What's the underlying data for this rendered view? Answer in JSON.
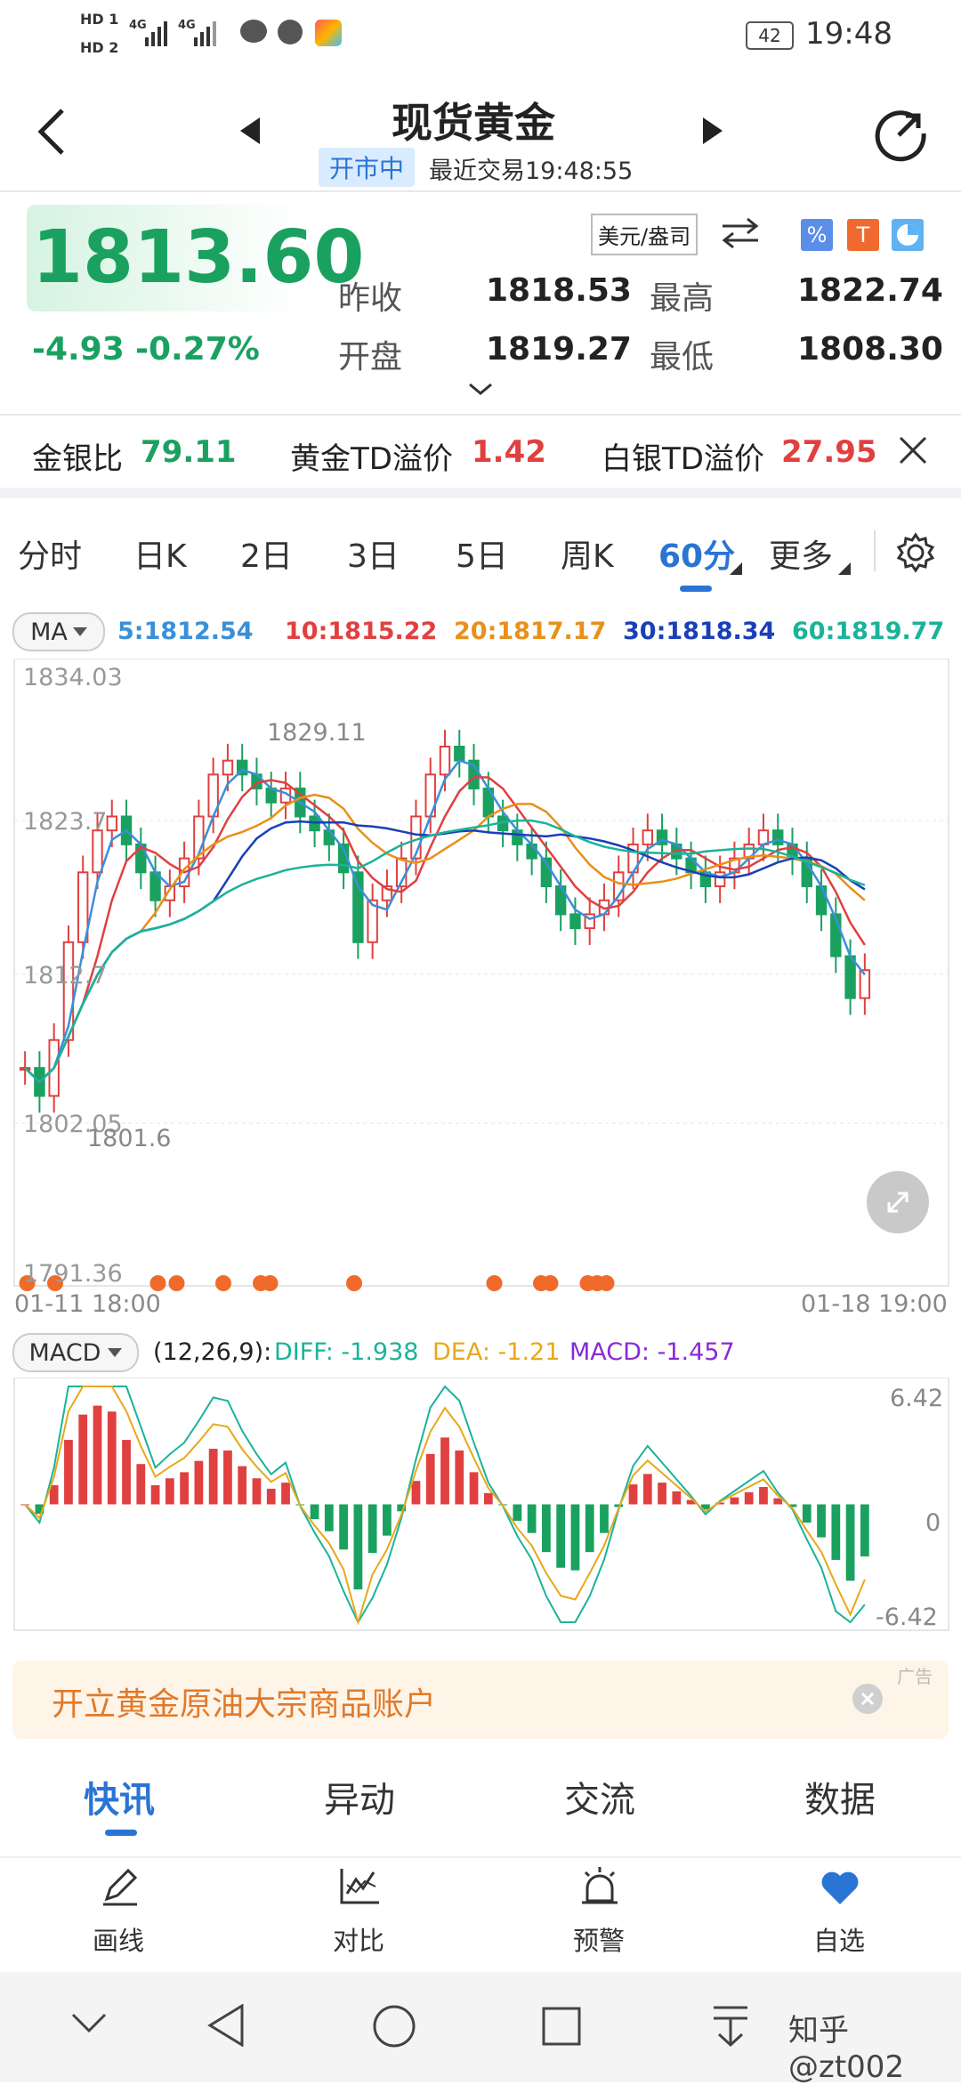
{
  "status": {
    "sim1": "HD 1",
    "sim2": "HD 2",
    "net1": "4G",
    "net2": "4G",
    "battery": "42",
    "time": "19:48"
  },
  "header": {
    "title": "现货黄金",
    "market_status": "开市中",
    "last_trade": "最近交易19:48:55"
  },
  "quote": {
    "price": "1813.60",
    "change": "-4.93",
    "change_pct": "-0.27%",
    "unit": "美元/盎司",
    "prev_close_label": "昨收",
    "prev_close": "1818.53",
    "open_label": "开盘",
    "open": "1819.27",
    "high_label": "最高",
    "high": "1822.74",
    "low_label": "最低",
    "low": "1808.30"
  },
  "spreads": {
    "gold_silver_label": "金银比",
    "gold_silver": "79.11",
    "gold_td_label": "黄金TD溢价",
    "gold_td": "1.42",
    "silver_td_label": "白银TD溢价",
    "silver_td": "27.95"
  },
  "period_tabs": [
    "分时",
    "日K",
    "2日",
    "3日",
    "5日",
    "周K",
    "60分",
    "更多"
  ],
  "ma": {
    "selector": "MA",
    "ma5": "5:1812.54",
    "ma10": "10:1815.22",
    "ma20": "20:1817.17",
    "ma30": "30:1818.34",
    "ma60": "60:1819.77",
    "colors": {
      "ma5": "#3a8fd9",
      "ma10": "#e04040",
      "ma20": "#e8901a",
      "ma30": "#1a3fb8",
      "ma60": "#1ab39a"
    }
  },
  "chart_data": [
    {
      "type": "candlestick",
      "title": "",
      "y_ticks": [
        "1834.03",
        "1823.7",
        "1812.7",
        "1802.05",
        "1791.36"
      ],
      "annotations": [
        "1829.11",
        "1801.6"
      ],
      "x_labels": [
        "01-11 18:00",
        "01-18 19:00"
      ],
      "ylim": [
        1791.36,
        1834.03
      ],
      "colors": {
        "up": "#e04040",
        "down": "#1aa160"
      }
    },
    {
      "type": "macd",
      "params": "(12,26,9):",
      "diff": "DIFF: -1.938",
      "dea": "DEA: -1.21",
      "macd": "MACD: -1.457",
      "y_ticks": [
        "6.42",
        "0",
        "-6.42"
      ],
      "ylim": [
        -6.42,
        6.42
      ]
    }
  ],
  "macd_selector": "MACD",
  "ad": {
    "text": "开立黄金原油大宗商品账户",
    "tag": "广告"
  },
  "bottom_tabs": [
    "快讯",
    "异动",
    "交流",
    "数据"
  ],
  "tools": [
    {
      "label": "画线",
      "icon": "pen-icon"
    },
    {
      "label": "对比",
      "icon": "compare-chart-icon"
    },
    {
      "label": "预警",
      "icon": "alarm-icon"
    },
    {
      "label": "自选",
      "icon": "heart-icon"
    }
  ],
  "watermark": "知乎 @zt002"
}
